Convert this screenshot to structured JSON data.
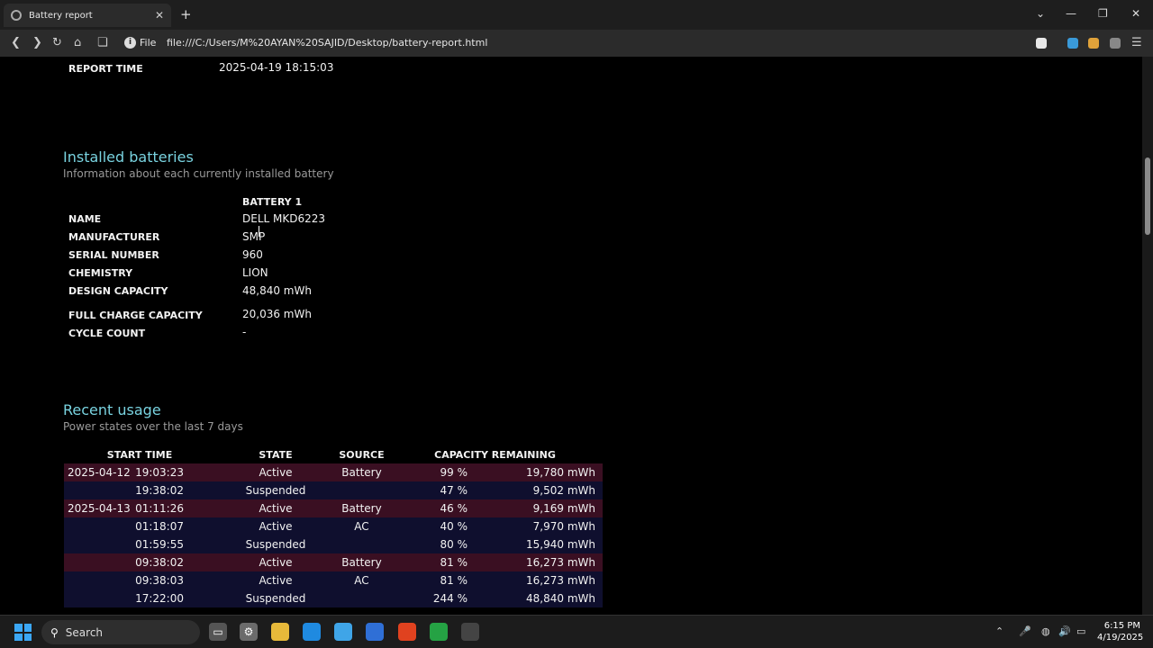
{
  "browser": {
    "tab_title": "Battery report",
    "new_tab": "+",
    "file_label": "File",
    "url": "file:///C:/Users/M%20AYAN%20SAJID/Desktop/battery-report.html"
  },
  "report": {
    "report_time_label": "REPORT TIME",
    "report_time_value": "2025-04-19  18:15:03"
  },
  "installed": {
    "title": "Installed batteries",
    "subtitle": "Information about each currently installed battery",
    "battery_header": "BATTERY 1",
    "rows": [
      {
        "label": "NAME",
        "value": "DELL MKD6223"
      },
      {
        "label": "MANUFACTURER",
        "value": "SMP"
      },
      {
        "label": "SERIAL NUMBER",
        "value": "960"
      },
      {
        "label": "CHEMISTRY",
        "value": "LION"
      },
      {
        "label": "DESIGN CAPACITY",
        "value": "48,840 mWh"
      },
      {
        "label": "FULL CHARGE CAPACITY",
        "value": "20,036 mWh"
      },
      {
        "label": "CYCLE COUNT",
        "value": "-"
      }
    ]
  },
  "usage": {
    "title": "Recent usage",
    "subtitle": "Power states over the last 7 days",
    "headers": [
      "START TIME",
      "STATE",
      "SOURCE",
      "CAPACITY REMAINING"
    ],
    "rows": [
      {
        "date": "2025-04-12",
        "time": "19:03:23",
        "state": "Active",
        "source": "Battery",
        "pct": "99 %",
        "mwh": "19,780 mWh"
      },
      {
        "date": "",
        "time": "19:38:02",
        "state": "Suspended",
        "source": "",
        "pct": "47 %",
        "mwh": "9,502 mWh"
      },
      {
        "date": "2025-04-13",
        "time": "01:11:26",
        "state": "Active",
        "source": "Battery",
        "pct": "46 %",
        "mwh": "9,169 mWh"
      },
      {
        "date": "",
        "time": "01:18:07",
        "state": "Active",
        "source": "AC",
        "pct": "40 %",
        "mwh": "7,970 mWh"
      },
      {
        "date": "",
        "time": "01:59:55",
        "state": "Suspended",
        "source": "",
        "pct": "80 %",
        "mwh": "15,940 mWh"
      },
      {
        "date": "",
        "time": "09:38:02",
        "state": "Active",
        "source": "Battery",
        "pct": "81 %",
        "mwh": "16,273 mWh"
      },
      {
        "date": "",
        "time": "09:38:03",
        "state": "Active",
        "source": "AC",
        "pct": "81 %",
        "mwh": "16,273 mWh"
      },
      {
        "date": "",
        "time": "17:22:00",
        "state": "Suspended",
        "source": "",
        "pct": "244 %",
        "mwh": "48,840 mWh"
      }
    ]
  },
  "taskbar": {
    "search_label": "Search",
    "time": "6:15 PM",
    "date": "4/19/2025"
  }
}
